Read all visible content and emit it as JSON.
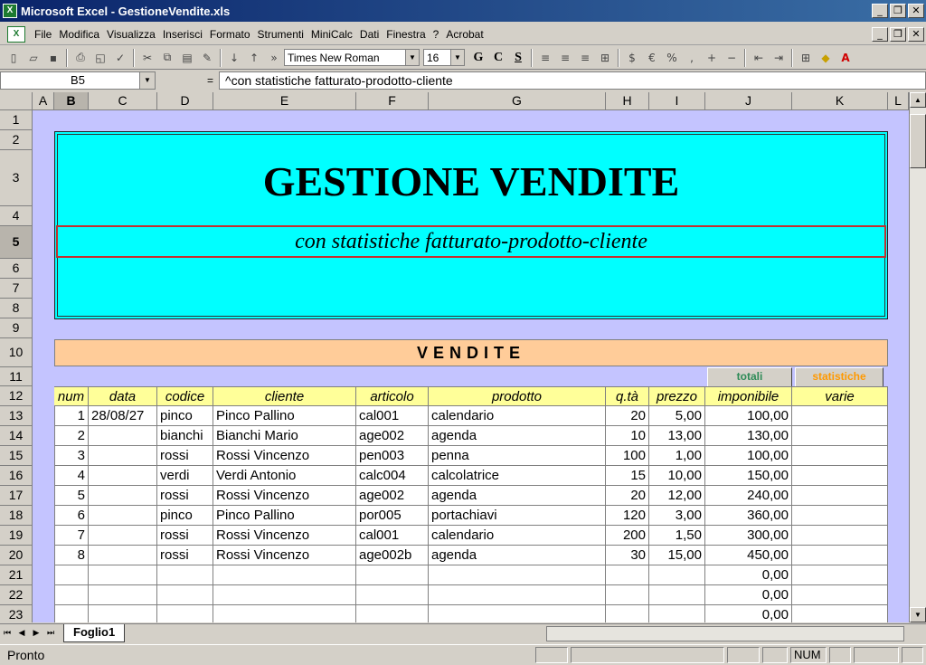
{
  "window": {
    "title": "Microsoft Excel - GestioneVendite.xls"
  },
  "menu": [
    "File",
    "Modifica",
    "Visualizza",
    "Inserisci",
    "Formato",
    "Strumenti",
    "MiniCalc",
    "Dati",
    "Finestra",
    "?",
    "Acrobat"
  ],
  "toolbar": {
    "font_name": "Times New Roman",
    "font_size": "16",
    "bold": "G",
    "italic": "C",
    "underline": "S"
  },
  "formula": {
    "cell_ref": "B5",
    "eq": "=",
    "content": "^con statistiche fatturato-prodotto-cliente"
  },
  "columns": [
    "A",
    "B",
    "C",
    "D",
    "E",
    "F",
    "G",
    "H",
    "I",
    "J",
    "K",
    "L"
  ],
  "rows": [
    "1",
    "2",
    "3",
    "4",
    "5",
    "6",
    "7",
    "8",
    "9",
    "10",
    "11",
    "12",
    "13",
    "14",
    "15",
    "16",
    "17",
    "18",
    "19",
    "20",
    "21",
    "22",
    "23"
  ],
  "sheet": {
    "title": "GESTIONE VENDITE",
    "subtitle": "con statistiche fatturato-prodotto-cliente",
    "section": "VENDITE",
    "btn_totali": "totali",
    "btn_statistiche": "statistiche",
    "headers": [
      "num",
      "data",
      "codice",
      "cliente",
      "articolo",
      "prodotto",
      "q.tà",
      "prezzo",
      "imponibile",
      "varie"
    ],
    "data_rows": [
      [
        "1",
        "28/08/27",
        "pinco",
        "Pinco Pallino",
        "cal001",
        "calendario",
        "20",
        "5,00",
        "100,00",
        ""
      ],
      [
        "2",
        "",
        "bianchi",
        "Bianchi Mario",
        "age002",
        "agenda",
        "10",
        "13,00",
        "130,00",
        ""
      ],
      [
        "3",
        "",
        "rossi",
        "Rossi Vincenzo",
        "pen003",
        "penna",
        "100",
        "1,00",
        "100,00",
        ""
      ],
      [
        "4",
        "",
        "verdi",
        "Verdi Antonio",
        "calc004",
        "calcolatrice",
        "15",
        "10,00",
        "150,00",
        ""
      ],
      [
        "5",
        "",
        "rossi",
        "Rossi Vincenzo",
        "age002",
        "agenda",
        "20",
        "12,00",
        "240,00",
        ""
      ],
      [
        "6",
        "",
        "pinco",
        "Pinco Pallino",
        "por005",
        "portachiavi",
        "120",
        "3,00",
        "360,00",
        ""
      ],
      [
        "7",
        "",
        "rossi",
        "Rossi Vincenzo",
        "cal001",
        "calendario",
        "200",
        "1,50",
        "300,00",
        ""
      ],
      [
        "8",
        "",
        "rossi",
        "Rossi Vincenzo",
        "age002b",
        "agenda",
        "30",
        "15,00",
        "450,00",
        ""
      ],
      [
        "",
        "",
        "",
        "",
        "",
        "",
        "",
        "",
        "0,00",
        ""
      ],
      [
        "",
        "",
        "",
        "",
        "",
        "",
        "",
        "",
        "0,00",
        ""
      ],
      [
        "",
        "",
        "",
        "",
        "",
        "",
        "",
        "",
        "0,00",
        ""
      ]
    ]
  },
  "tabs": {
    "active": "Foglio1"
  },
  "status": {
    "text": "Pronto",
    "num": "NUM"
  },
  "colors": {
    "header_bg": "#00ffff",
    "section_bg": "#ffcc99",
    "table_header_bg": "#ffff99",
    "sheet_bg": "#c4c4ff",
    "totali_color": "#2e8b57",
    "statistiche_color": "#ff9900"
  }
}
